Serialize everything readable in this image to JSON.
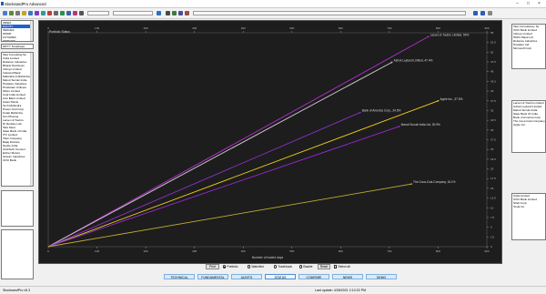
{
  "window": {
    "title": "StocksandPro Advanced"
  },
  "left_panel": {
    "list1": [
      "INDEX",
      "EQUITY",
      "INDICES",
      "WORK",
      "FUTURES",
      "OPTIONS"
    ],
    "list1_selected": 1,
    "nifty_label": "NIFTY Smallcaps",
    "list2": [
      "Tata Consulting Se",
      "Cipla Limited",
      "Reliance Industries",
      "Bharat Petroleum",
      "Infosys Limited",
      "Indusind Bank",
      "Mahindra & Mahindra",
      "Maruti Suzuki India",
      "Hindalco Industries",
      "Hindustan Unilever",
      "Wipro Limited",
      "Coal India Limited",
      "Axis Bank Limited",
      "Asian Paints",
      "Tech Mahindra",
      "Power Grid Corp",
      "Kotak Mahindra",
      "Sun Pharma",
      "Larsen & Toubro",
      "Dr Reddys Lab",
      "Tata Steel",
      "State Bank of India",
      "ITC Limited",
      "Titan Company",
      "Bajaj Finance",
      "Nestle India",
      "UltraTech Cement",
      "Eicher Motors",
      "Grasim Industries",
      "ICICI Bank"
    ]
  },
  "right_panel": {
    "list1": [
      "Tata Consultancy Se",
      "ICICI Bank Limited",
      "Infosys Limited",
      "HDFC Bank Ltd",
      "Reliance Industries",
      "Hindalco Ind",
      "Microsoft Corp"
    ],
    "list2": [
      "Larsen & Toubro Limited",
      "Ashok Leyland Limited",
      "Maruti Suzuki India",
      "State Bank Of India",
      "Bank of America Corp",
      "The Coca Cola Company",
      "Apple Inc."
    ],
    "list3": [
      "Cipla Limited",
      "ICICI Bank Limited",
      "Shell Corp.",
      "Tesla Inc."
    ]
  },
  "chart_data": {
    "type": "line",
    "title": "Portfolio Status",
    "xlabel": "Number of traded days",
    "ylabel": "",
    "xlim": [
      0,
      900
    ],
    "ylim": [
      0,
      55
    ],
    "x_ticks_top": [
      "0",
      "100",
      "200",
      "300",
      "400",
      "500",
      "600",
      "700",
      "800",
      "900"
    ],
    "x_ticks_bottom": [
      "0",
      "100",
      "200",
      "300",
      "400",
      "500",
      "600",
      "700",
      "800",
      "900"
    ],
    "y_ticks": [
      "0",
      "2.5",
      "5",
      "7.5",
      "10",
      "12.5",
      "15",
      "17.5",
      "20",
      "22.5",
      "25",
      "27.5",
      "30",
      "32.5",
      "35",
      "37.5",
      "40",
      "42.5",
      "45",
      "47.5",
      "50",
      "52.5",
      "55"
    ],
    "grid": false,
    "series": [
      {
        "name": "Larsen & Toubro Limited, 54%",
        "color": "#b62fd0",
        "x": [
          0,
          780
        ],
        "y": [
          0,
          54
        ]
      },
      {
        "name": "Ashok Leyland Limited, 47.4%",
        "color": "#cfcfcf",
        "x": [
          0,
          705
        ],
        "y": [
          0,
          47.4
        ]
      },
      {
        "name": "Apple Inc., 37.5%",
        "color": "#f1d21b",
        "x": [
          0,
          800
        ],
        "y": [
          0,
          37.5
        ]
      },
      {
        "name": "Bank of America Corp., 34.5%",
        "color": "#8c32c8",
        "x": [
          0,
          640
        ],
        "y": [
          0,
          34.5
        ]
      },
      {
        "name": "Maruti Suzuki India Ltd, 30.9%",
        "color": "#9b2ad4",
        "x": [
          0,
          720
        ],
        "y": [
          0,
          30.9
        ]
      },
      {
        "name": "The Coca-Cola Company, 16.1%",
        "color": "#bfae33",
        "x": [
          0,
          745
        ],
        "y": [
          0,
          16.1
        ]
      }
    ]
  },
  "controls": {
    "print_label": "Print",
    "radio_portfolio": "Portfolio",
    "radio_watchlist": "Watchlist",
    "radio_trade": "Tradebook",
    "radio_basket": "Basket",
    "reset_label": "Reset",
    "select_all": "Select all"
  },
  "tabs": [
    "TECHNICAL",
    "FUNDAMENTAL",
    "AUDITS",
    "STATUS",
    "COMPARE",
    "NEWS",
    "DEMO"
  ],
  "tab_active": 3,
  "status": {
    "version": "StocksandPro v5.3",
    "last_update": "Last update: 4/28/2021 2:10:22 PM"
  },
  "colors": {
    "chart_bg": "#1d1d1d",
    "axis": "#9a9a9a",
    "selection": "#1e62d0"
  }
}
